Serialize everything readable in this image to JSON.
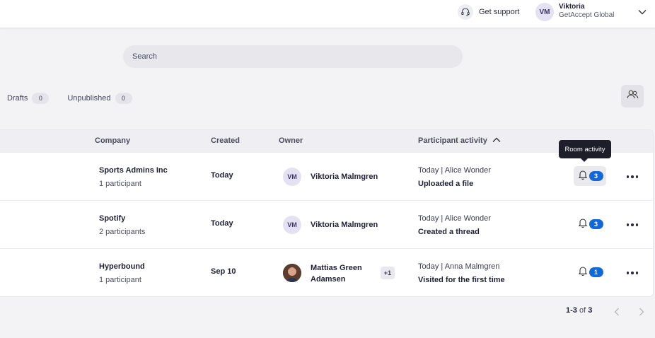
{
  "topbar": {
    "support_label": "Get support",
    "user": {
      "initials": "VM",
      "name": "Viktoria",
      "org": "GetAccept Global"
    }
  },
  "search": {
    "placeholder": "Search",
    "value": ""
  },
  "filters": [
    {
      "label": "Drafts",
      "count": "0"
    },
    {
      "label": "Unpublished",
      "count": "0"
    }
  ],
  "table": {
    "headers": {
      "company": "Company",
      "created": "Created",
      "owner": "Owner",
      "activity": "Participant activity"
    },
    "rows": [
      {
        "company": "Sports Admins Inc",
        "participants": "1 participant",
        "created": "Today",
        "owner_initials": "VM",
        "owner_name": "Viktoria Malmgren",
        "activity_meta": "Today | Alice Wonder",
        "activity_action": "Uploaded a file",
        "notifications": "3"
      },
      {
        "company": "Spotify",
        "participants": "2 participants",
        "created": "Today",
        "owner_initials": "VM",
        "owner_name": "Viktoria Malmgren",
        "activity_meta": "Today | Alice Wonder",
        "activity_action": "Created a thread",
        "notifications": "3"
      },
      {
        "company": "Hyperbound",
        "participants": "1 participant",
        "created": "Sep 10",
        "owner_name": "Mattias Green Adamsen",
        "extra_owners": "+1",
        "activity_meta": "Today | Anna Malmgren",
        "activity_action": "Visited for the first time",
        "notifications": "1"
      }
    ]
  },
  "tooltip": {
    "text": "Room activity"
  },
  "pagination": {
    "range": "1-3",
    "of_label": "of",
    "total": "3"
  },
  "colors": {
    "accent": "#1468d6",
    "avatar_bg": "#e4e1f3",
    "tooltip_bg": "#1e1e2a"
  },
  "icons": [
    "headset-icon",
    "chevron-down-icon",
    "people-icon",
    "sort-up-icon",
    "bell-icon",
    "more-icon",
    "chevron-left-icon",
    "chevron-right-icon"
  ]
}
